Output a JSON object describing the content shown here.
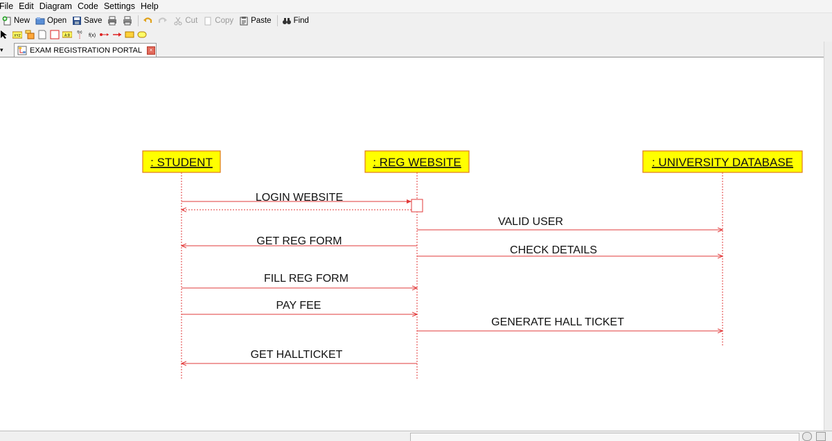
{
  "menu": [
    "File",
    "Edit",
    "Diagram",
    "Code",
    "Settings",
    "Help"
  ],
  "toolbar": {
    "new": "New",
    "open": "Open",
    "save": "Save",
    "cut": "Cut",
    "copy": "Copy",
    "paste": "Paste",
    "find": "Find"
  },
  "tab": {
    "label": "EXAM REGISTRATION PORTAL"
  },
  "diagram": {
    "lifelines": [
      {
        "label": ": STUDENT"
      },
      {
        "label": ": REG WEBSITE"
      },
      {
        "label": ": UNIVERSITY DATABASE"
      }
    ],
    "messages": [
      {
        "label": "LOGIN WEBSITE",
        "from": 0,
        "to": 1
      },
      {
        "label": "VALID USER",
        "from": 1,
        "to": 2
      },
      {
        "label": "GET REG FORM",
        "from": 1,
        "to": 0
      },
      {
        "label": "CHECK DETAILS",
        "from": 1,
        "to": 2
      },
      {
        "label": "FILL REG FORM",
        "from": 0,
        "to": 1
      },
      {
        "label": "PAY FEE",
        "from": 0,
        "to": 1
      },
      {
        "label": "GENERATE HALL TICKET",
        "from": 1,
        "to": 2
      },
      {
        "label": "GET HALLTICKET",
        "from": 1,
        "to": 0
      }
    ],
    "colors": {
      "line": "#e23a3a",
      "box_fill": "#ffff00",
      "box_border": "#e07a1a"
    }
  }
}
